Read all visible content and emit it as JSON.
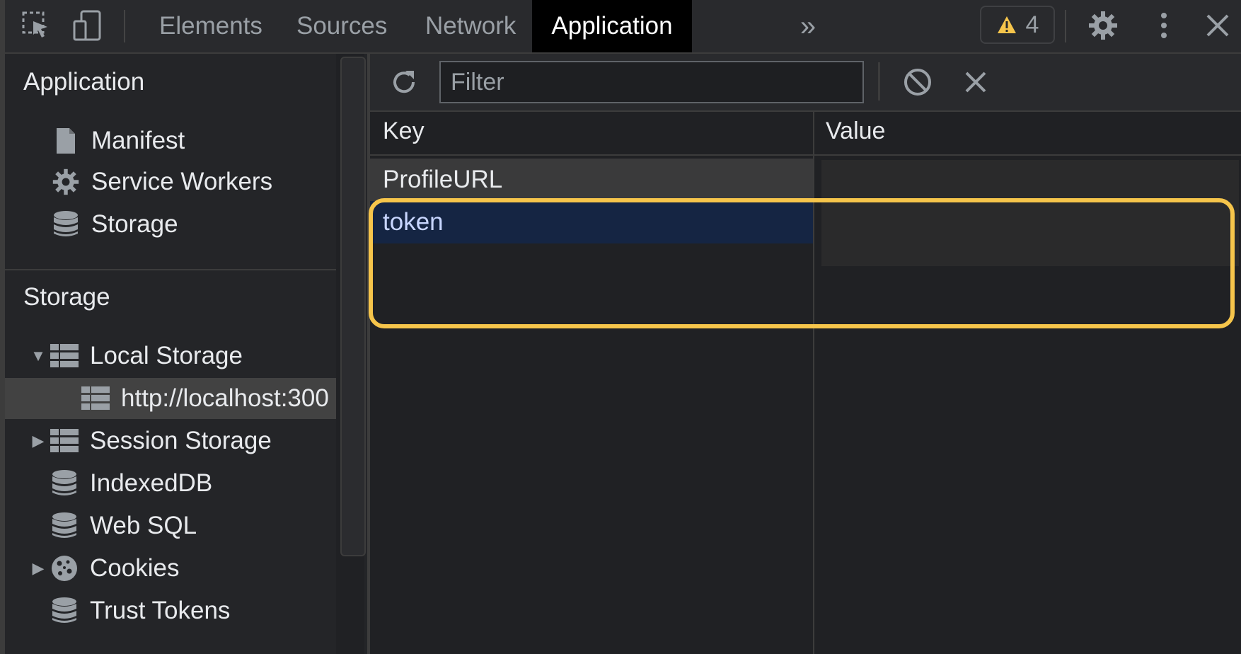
{
  "toolbar": {
    "tabs": [
      "Elements",
      "Sources",
      "Network",
      "Application"
    ],
    "active_tab": "Application",
    "more_label": "»",
    "warning_count": "4"
  },
  "sidebar": {
    "application_title": "Application",
    "application_items": [
      "Manifest",
      "Service Workers",
      "Storage"
    ],
    "storage_title": "Storage",
    "storage_items": {
      "local_storage": "Local Storage",
      "local_origin": "http://localhost:300",
      "session_storage": "Session Storage",
      "indexeddb": "IndexedDB",
      "websql": "Web SQL",
      "cookies": "Cookies",
      "trust_tokens": "Trust Tokens"
    }
  },
  "filter": {
    "placeholder": "Filter"
  },
  "table": {
    "columns": [
      "Key",
      "Value"
    ],
    "rows": [
      {
        "key": "ProfileURL",
        "value": ""
      },
      {
        "key": "token",
        "value": ""
      }
    ]
  },
  "colors": {
    "highlight": "#f6c54b",
    "selected_row": "#152543",
    "active_tab_bg": "#000000"
  }
}
